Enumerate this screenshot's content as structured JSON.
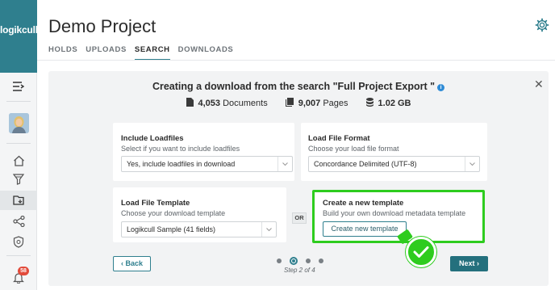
{
  "app": {
    "logo_text": "logikcull",
    "title": "Demo Project"
  },
  "tabs": [
    {
      "label": "HOLDS",
      "active": false
    },
    {
      "label": "UPLOADS",
      "active": false
    },
    {
      "label": "SEARCH",
      "active": true
    },
    {
      "label": "DOWNLOADS",
      "active": false
    }
  ],
  "sidebar": {
    "icons": [
      "menu-collapse-icon",
      "home-icon",
      "funnel-icon",
      "folder-icon",
      "share-icon",
      "shield-icon",
      "bell-icon"
    ],
    "notification_count": "58"
  },
  "modal": {
    "title": "Creating a download from the search \"Full Project Export \"",
    "stats": {
      "documents_value": "4,053",
      "documents_label": "Documents",
      "pages_value": "9,007",
      "pages_label": "Pages",
      "size_value": "1.02 GB"
    },
    "include_loadfiles": {
      "label": "Include Loadfiles",
      "sub": "Select if you want to include loadfiles",
      "value": "Yes, include loadfiles in download"
    },
    "load_file_format": {
      "label": "Load File Format",
      "sub": "Choose your load file format",
      "value": "Concordance Delimited (UTF-8)"
    },
    "load_file_template": {
      "label": "Load File Template",
      "sub": "Choose your download template",
      "value": "Logikcull Sample (41 fields)"
    },
    "or_label": "OR",
    "new_template": {
      "label": "Create a new template",
      "sub": "Build your own download metadata template",
      "button": "Create new template"
    },
    "back_label": "‹ Back",
    "next_label": "Next ›",
    "step_text": "Step 2 of 4",
    "step_current": 2,
    "step_total": 4
  },
  "colors": {
    "brand": "#2f7f8e",
    "highlight": "#2ecc1e",
    "info": "#2e8bd6",
    "badge": "#e24b3b"
  }
}
